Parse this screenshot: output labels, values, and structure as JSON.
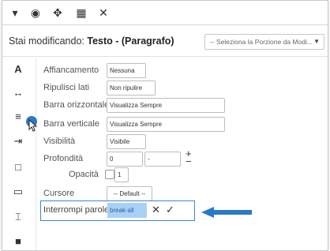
{
  "toolbar": {
    "icons": [
      "chevron-down-icon",
      "eye-icon",
      "move-icon",
      "grid-icon",
      "close-icon"
    ],
    "glyphs": [
      "▾",
      "◉",
      "✥",
      "▦",
      "✕"
    ]
  },
  "header": {
    "prefix": "Stai modificando: ",
    "subject": "Testo - (Paragrafo)",
    "portion_select": "-- Seleziona la Porzione da Modi..."
  },
  "sidebar": {
    "icons": [
      {
        "name": "font-a-icon",
        "glyph": "A"
      },
      {
        "name": "width-arrows-icon",
        "glyph": "↔"
      },
      {
        "name": "paragraph-align-icon",
        "glyph": "≡"
      },
      {
        "name": "indent-icon",
        "glyph": "⇥"
      },
      {
        "name": "box-icon",
        "glyph": "□"
      },
      {
        "name": "image-frame-icon",
        "glyph": "▭"
      },
      {
        "name": "text-wrap-icon",
        "glyph": "⌶"
      },
      {
        "name": "square-fill-icon",
        "glyph": "■"
      }
    ]
  },
  "form": {
    "affiancamento": {
      "label": "Affiancamento",
      "value": "Nessuna"
    },
    "ripulisci": {
      "label": "Ripulisci lati",
      "value": "Non ripulire"
    },
    "barra_oriz": {
      "label": "Barra orizzontale",
      "value": "Visualizza Sempre"
    },
    "barra_vert": {
      "label": "Barra verticale",
      "value": "Visualizza Sempre"
    },
    "visibilita": {
      "label": "Visibilità",
      "value": "Visibile"
    },
    "profondita": {
      "label": "Profondità",
      "value": "0",
      "select": "-",
      "plus": "+",
      "minus": "−"
    },
    "opacita": {
      "label": "Opacità",
      "value": "1"
    },
    "cursore": {
      "label": "Cursore",
      "value": "-- Default --"
    },
    "interrompi": {
      "label": "Interrompi parole",
      "value": "break-all",
      "cancel": "✕",
      "confirm": "✓"
    }
  },
  "colors": {
    "accent": "#3d86d6",
    "arrow": "#2a79c9",
    "selection": "#a9d1f5"
  }
}
